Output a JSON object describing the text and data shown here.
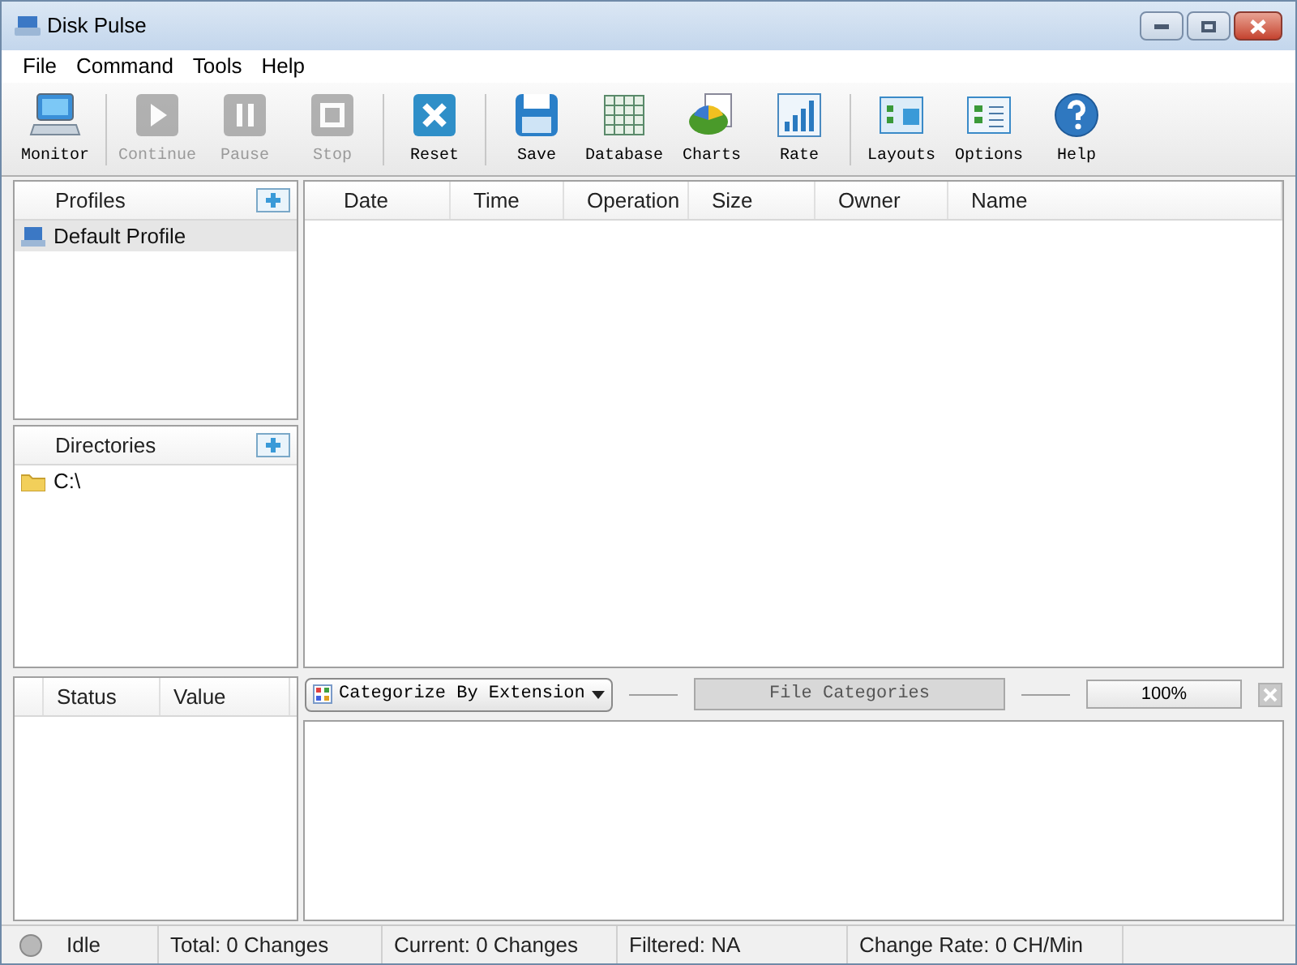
{
  "window": {
    "title": "Disk Pulse"
  },
  "menu": [
    "File",
    "Command",
    "Tools",
    "Help"
  ],
  "toolbar": [
    [
      {
        "label": "Monitor",
        "disabled": false
      }
    ],
    [
      {
        "label": "Continue",
        "disabled": true
      },
      {
        "label": "Pause",
        "disabled": true
      },
      {
        "label": "Stop",
        "disabled": true
      }
    ],
    [
      {
        "label": "Reset",
        "disabled": false
      }
    ],
    [
      {
        "label": "Save",
        "disabled": false
      },
      {
        "label": "Database",
        "disabled": false
      },
      {
        "label": "Charts",
        "disabled": false
      },
      {
        "label": "Rate",
        "disabled": false
      }
    ],
    [
      {
        "label": "Layouts",
        "disabled": false
      },
      {
        "label": "Options",
        "disabled": false
      },
      {
        "label": "Help",
        "disabled": false
      }
    ]
  ],
  "profiles": {
    "title": "Profiles",
    "items": [
      {
        "label": "Default Profile",
        "selected": true
      }
    ]
  },
  "directories": {
    "title": "Directories",
    "items": [
      {
        "label": "C:\\",
        "selected": false
      }
    ]
  },
  "table": {
    "columns": [
      "Date",
      "Time",
      "Operation",
      "Size",
      "Owner",
      "Name"
    ]
  },
  "status_panel": {
    "columns": [
      "Status",
      "Value"
    ]
  },
  "categories_bar": {
    "dropdown": "Categorize By Extension",
    "button": "File Categories",
    "percent": "100%"
  },
  "status_bar": [
    "Idle",
    "Total: 0 Changes",
    "Current: 0 Changes",
    "Filtered: NA",
    "Change Rate: 0 CH/Min"
  ]
}
